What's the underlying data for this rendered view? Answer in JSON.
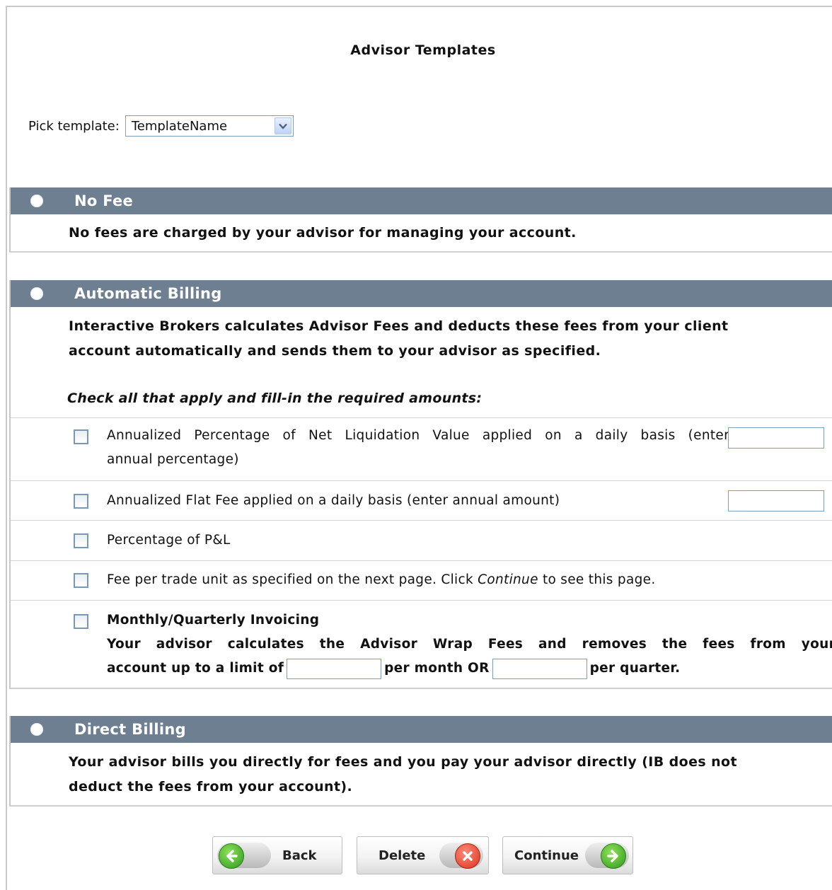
{
  "page": {
    "title": "Advisor Templates"
  },
  "picker": {
    "label": "Pick template:",
    "selected": "TemplateName"
  },
  "sections": {
    "no_fee": {
      "title": "No Fee",
      "description": "No fees are charged by your advisor for managing your account."
    },
    "automatic_billing": {
      "title": "Automatic Billing",
      "description_line1": "Interactive Brokers calculates Advisor Fees and deducts these fees from your client",
      "description_line2": "account automatically and sends them to your advisor as specified.",
      "instruction": "Check all that apply and fill-in the required amounts:",
      "options": {
        "nlv_line1": "Annualized Percentage of Net Liquidation Value applied on a daily basis (enter",
        "nlv_line2": "annual percentage)",
        "flat_fee": "Annualized Flat Fee applied on a daily basis (enter annual amount)",
        "pnl": "Percentage of P&L",
        "per_trade_before": "Fee per trade unit as specified on the next page. Click ",
        "per_trade_italic": "Continue",
        "per_trade_after": " to see this page.",
        "invoicing_title": "Monthly/Quarterly Invoicing",
        "invoicing_line1": "Your advisor calculates the Advisor Wrap Fees and removes the fees from your",
        "invoicing_prefix": "account up to a limit of",
        "invoicing_mid": "per month OR",
        "invoicing_suffix": "per quarter."
      }
    },
    "direct_billing": {
      "title": "Direct Billing",
      "description_line1": "Your advisor bills you directly for fees and you pay your advisor directly (IB does not",
      "description_line2": "deduct the fees from your account)."
    }
  },
  "buttons": {
    "back": "Back",
    "delete": "Delete",
    "continue": "Continue"
  },
  "colors": {
    "section_header": "#6e7f92",
    "go_green": "#3aa82a",
    "delete_red": "#e0442c"
  }
}
